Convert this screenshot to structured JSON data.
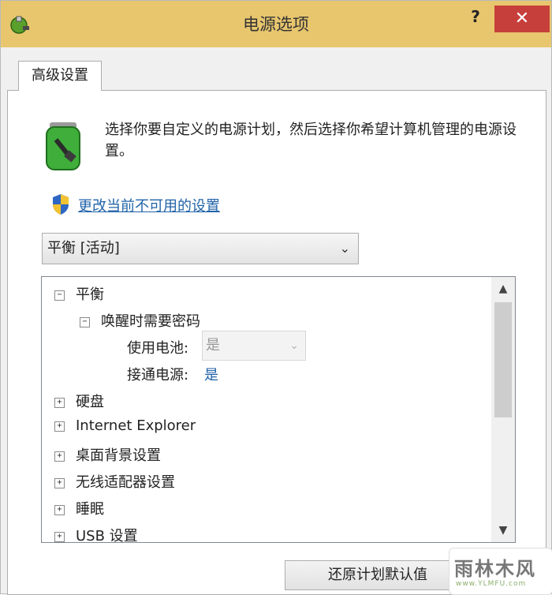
{
  "window": {
    "title": "电源选项",
    "help_label": "?",
    "close_label": "✕"
  },
  "tab": {
    "label": "高级设置"
  },
  "header": {
    "description": "选择你要自定义的电源计划，然后选择你希望计算机管理的电源设置。",
    "change_link": "更改当前不可用的设置"
  },
  "plan_select": {
    "value": "平衡 [活动]"
  },
  "tree": {
    "root": {
      "label": "平衡",
      "expander": "−"
    },
    "child": {
      "label": "唤醒时需要密码",
      "expander": "−"
    },
    "on_battery": {
      "label": "使用电池:",
      "value": "是"
    },
    "plugged_in": {
      "label": "接通电源:",
      "value": "是"
    },
    "items": [
      {
        "label": "硬盘",
        "expander": "+"
      },
      {
        "label": "Internet Explorer",
        "expander": "+"
      },
      {
        "label": "桌面背景设置",
        "expander": "+"
      },
      {
        "label": "无线适配器设置",
        "expander": "+"
      },
      {
        "label": "睡眠",
        "expander": "+"
      },
      {
        "label": "USB 设置",
        "expander": "+"
      }
    ]
  },
  "buttons": {
    "restore_defaults": "还原计划默认值"
  },
  "watermark": {
    "text": "雨林木风",
    "url": "www.YLMFU.com"
  }
}
